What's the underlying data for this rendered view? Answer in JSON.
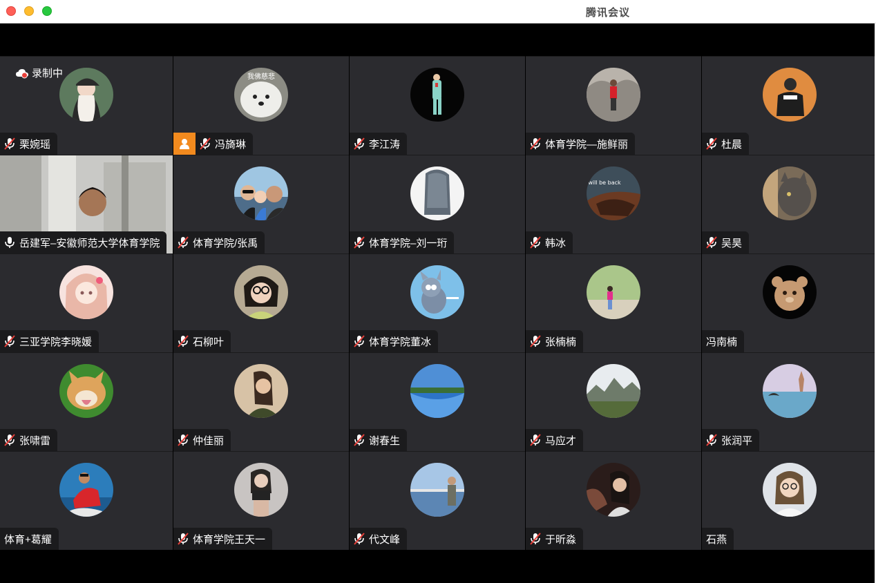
{
  "window": {
    "title": "腾讯会议"
  },
  "recording": {
    "label": "录制中"
  },
  "participants": [
    {
      "name": "栗婉瑶",
      "mic": "muted",
      "avatar": "cartoon-girl-cap"
    },
    {
      "name": "冯旖琳",
      "mic": "muted",
      "avatar": "white-dog",
      "host": true,
      "avatar_text": "我佛慈悲"
    },
    {
      "name": "李江涛",
      "mic": "muted",
      "avatar": "man-suit-black"
    },
    {
      "name": "体育学院—施鲜丽",
      "mic": "muted",
      "avatar": "woman-rocks"
    },
    {
      "name": "杜晨",
      "mic": "muted",
      "avatar": "man-sitting-orange"
    },
    {
      "name": "岳建军–安徽师范大学体育学院",
      "mic": "on",
      "avatar": "video-feed"
    },
    {
      "name": "体育学院/张禹",
      "mic": "muted",
      "avatar": "family-selfie"
    },
    {
      "name": "体育学院–刘一珩",
      "mic": "muted",
      "avatar": "hair-back"
    },
    {
      "name": "韩冰",
      "mic": "muted",
      "avatar": "will-be-back",
      "avatar_text": "will be back"
    },
    {
      "name": "吴昊",
      "mic": "muted",
      "avatar": "cat-window"
    },
    {
      "name": "三亚学院李晓媛",
      "mic": "muted",
      "avatar": "anime-girl"
    },
    {
      "name": "石柳叶",
      "mic": "muted",
      "avatar": "girl-glasses"
    },
    {
      "name": "体育学院董冰",
      "mic": "muted",
      "avatar": "tom-cat"
    },
    {
      "name": "张楠楠",
      "mic": "muted",
      "avatar": "girl-nature"
    },
    {
      "name": "冯南楠",
      "mic": "none",
      "avatar": "bear-black"
    },
    {
      "name": "张啸雷",
      "mic": "muted",
      "avatar": "shiba-dog"
    },
    {
      "name": "仲佳丽",
      "mic": "muted",
      "avatar": "woman-beige"
    },
    {
      "name": "谢春生",
      "mic": "muted",
      "avatar": "lake-sky"
    },
    {
      "name": "马应才",
      "mic": "muted",
      "avatar": "mountains"
    },
    {
      "name": "张润平",
      "mic": "muted",
      "avatar": "whale-sea"
    },
    {
      "name": "体育+葛耀",
      "mic": "none",
      "avatar": "man-red-sea"
    },
    {
      "name": "体育学院王天一",
      "mic": "muted",
      "avatar": "woman-mirror"
    },
    {
      "name": "代文峰",
      "mic": "muted",
      "avatar": "man-lake"
    },
    {
      "name": "于昕淼",
      "mic": "muted",
      "avatar": "woman-car"
    },
    {
      "name": "石燕",
      "mic": "none",
      "avatar": "woman-portrait"
    }
  ],
  "colors": {
    "tile_bg": "#2b2b2f",
    "label_bg": "#1b1b1d",
    "host_badge": "#f28a1e",
    "muted_red": "#e8403a",
    "recording_red": "#e8403a"
  }
}
